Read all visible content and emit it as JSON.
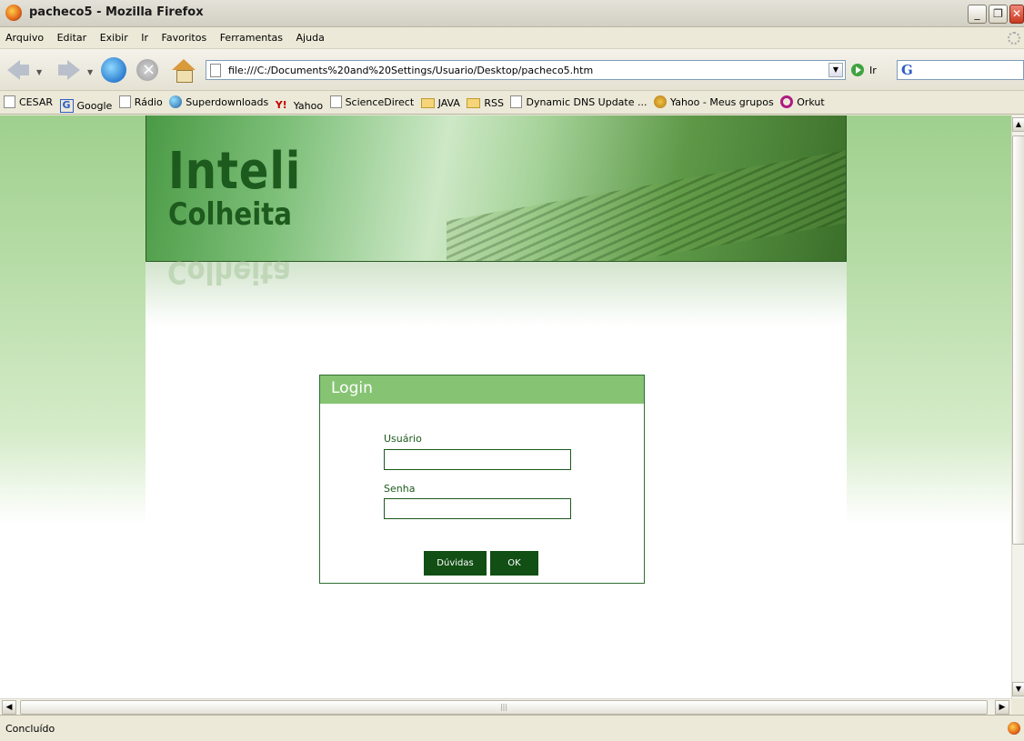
{
  "window": {
    "title": "pacheco5 - Mozilla Firefox",
    "buttons": {
      "minimize": "_",
      "restore": "❐",
      "close": "✕"
    }
  },
  "menu": [
    "Arquivo",
    "Editar",
    "Exibir",
    "Ir",
    "Favoritos",
    "Ferramentas",
    "Ajuda"
  ],
  "toolbar": {
    "url": "file:///C:/Documents%20and%20Settings/Usuario/Desktop/pacheco5.htm",
    "go_label": "Ir",
    "search_value": ""
  },
  "bookmarks": [
    {
      "label": "CESAR",
      "icon": "page-icon"
    },
    {
      "label": "Google",
      "icon": "google-icon"
    },
    {
      "label": "Rádio",
      "icon": "page-icon"
    },
    {
      "label": "Superdownloads",
      "icon": "globe-icon"
    },
    {
      "label": "Yahoo",
      "icon": "yahoo-icon"
    },
    {
      "label": "ScienceDirect",
      "icon": "page-icon"
    },
    {
      "label": "JAVA",
      "icon": "folder-icon"
    },
    {
      "label": "RSS",
      "icon": "folder-icon"
    },
    {
      "label": "Dynamic DNS Update ...",
      "icon": "page-icon"
    },
    {
      "label": "Yahoo - Meus grupos",
      "icon": "people-icon"
    },
    {
      "label": "Orkut",
      "icon": "orkut-icon"
    }
  ],
  "page": {
    "logo_line1": "Inteli",
    "logo_line2": "Colheita",
    "login": {
      "title": "Login",
      "user_label": "Usuário",
      "user_value": "",
      "password_label": "Senha",
      "password_value": "",
      "help_button": "Dúvidas",
      "ok_button": "OK"
    }
  },
  "status": {
    "text": "Concluído"
  },
  "colors": {
    "brand_green": "#1d5a1d",
    "login_header": "#86c474",
    "button_bg": "#114f14"
  }
}
